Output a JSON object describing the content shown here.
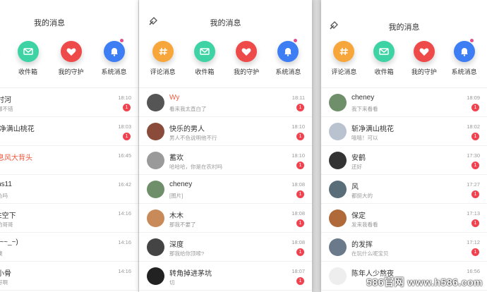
{
  "screen1": {
    "items": [
      {
        "name": "时河",
        "preview": "挪不错",
        "time": "18:10",
        "badge": "1",
        "red": false
      },
      {
        "name": "f净满山桃花",
        "preview": "",
        "time": "18:03",
        "badge": "1",
        "red": false
      },
      {
        "name": "息风大背头",
        "preview": "",
        "time": "16:45",
        "badge": "",
        "red": true
      },
      {
        "name": "ns11",
        "preview": "色吗",
        "time": "16:42",
        "badge": "",
        "red": false
      },
      {
        "name": "E空下",
        "preview": "的哥哥",
        "time": "14:16",
        "badge": "",
        "red": false
      },
      {
        "name": "(~~_~)",
        "preview": "噢",
        "time": "14:16",
        "badge": "",
        "red": false
      },
      {
        "name": "小骨",
        "preview": "好啊",
        "time": "14:16",
        "badge": "",
        "red": false
      }
    ]
  },
  "screen2": {
    "title": "我的消息",
    "icons": [
      {
        "label": "评论消息",
        "color": "#f7a63c"
      },
      {
        "label": "收件箱",
        "color": "#3ed3a4"
      },
      {
        "label": "我的守护",
        "color": "#ef4a4a"
      },
      {
        "label": "系统消息",
        "color": "#3d7ef5"
      }
    ],
    "items": [
      {
        "name": "Wy",
        "preview": "看来我太直白了",
        "time": "18:11",
        "badge": "1",
        "red": true,
        "av": "#555"
      },
      {
        "name": "快乐的男人",
        "preview": "男人不色说明他不行",
        "time": "18:10",
        "badge": "1",
        "red": false,
        "av": "#8b4b3b"
      },
      {
        "name": "蓄欢",
        "preview": "哈哈哈，你是在农村吗",
        "time": "18:10",
        "badge": "1",
        "red": false,
        "av": "#9a9a9a"
      },
      {
        "name": "cheney",
        "preview": "[图片]",
        "time": "18:08",
        "badge": "1",
        "red": false,
        "av": "#6f8f6a"
      },
      {
        "name": "木木",
        "preview": "那我不要了",
        "time": "18:08",
        "badge": "1",
        "red": false,
        "av": "#c98a5a"
      },
      {
        "name": "深度",
        "preview": "那我给你顶嗦?",
        "time": "18:08",
        "badge": "1",
        "red": false,
        "av": "#444"
      },
      {
        "name": "转角掉进茅坑",
        "preview": "切",
        "time": "18:07",
        "badge": "1",
        "red": false,
        "av": "#222"
      }
    ]
  },
  "screen3": {
    "title": "我的消息",
    "icons": [
      {
        "label": "评论消息",
        "color": "#f7a63c"
      },
      {
        "label": "收件箱",
        "color": "#3ed3a4"
      },
      {
        "label": "我的守护",
        "color": "#ef4a4a"
      },
      {
        "label": "系统消息",
        "color": "#3d7ef5"
      }
    ],
    "items": [
      {
        "name": "cheney",
        "preview": "我下来看看",
        "time": "18:09",
        "badge": "1",
        "red": false,
        "av": "#6f8f6a"
      },
      {
        "name": "斩净满山桃花",
        "preview": "嘻嘻！可以",
        "time": "18:02",
        "badge": "1",
        "red": false,
        "av": "#b9c3cf"
      },
      {
        "name": "安鹤",
        "preview": "还好",
        "time": "17:30",
        "badge": "1",
        "red": false,
        "av": "#333"
      },
      {
        "name": "风",
        "preview": "都挺大的",
        "time": "17:27",
        "badge": "1",
        "red": false,
        "av": "#5a6e7a"
      },
      {
        "name": "保定",
        "preview": "发来我看看",
        "time": "17:13",
        "badge": "1",
        "red": false,
        "av": "#b06a3a"
      },
      {
        "name": "的发挥",
        "preview": "在玩什么呢宝贝",
        "time": "17:12",
        "badge": "1",
        "red": false,
        "av": "#6a7a8a"
      },
      {
        "name": "陈年人少熬夜",
        "preview": "",
        "time": "16:56",
        "badge": "",
        "red": false,
        "av": "#eee"
      }
    ]
  },
  "watermark": "586官网 www.h586.com"
}
